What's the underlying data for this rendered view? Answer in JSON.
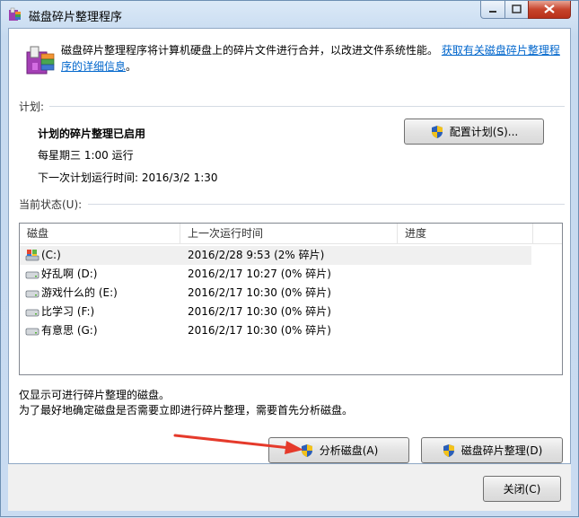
{
  "window": {
    "title": "磁盘碎片整理程序"
  },
  "header": {
    "description": "磁盘碎片整理程序将计算机硬盘上的碎片文件进行合并，以改进文件系统性能。",
    "link": "获取有关磁盘碎片整理程序的详细信息",
    "link_end": "。"
  },
  "schedule": {
    "section_label": "计划:",
    "status": "计划的碎片整理已启用",
    "frequency": "每星期三  1:00 运行",
    "next_run": "下一次计划运行时间: 2016/3/2 1:30",
    "configure_button": "配置计划(S)..."
  },
  "current_status": {
    "section_label": "当前状态(U):",
    "columns": [
      "磁盘",
      "上一次运行时间",
      "进度"
    ],
    "rows": [
      {
        "disk": "(C:)",
        "last_run": "2016/2/28 9:53 (2% 碎片)",
        "progress": "",
        "icon": "system-drive-icon"
      },
      {
        "disk": "好乱啊 (D:)",
        "last_run": "2016/2/17 10:27 (0% 碎片)",
        "progress": "",
        "icon": "drive-icon"
      },
      {
        "disk": "游戏什么的 (E:)",
        "last_run": "2016/2/17 10:30 (0% 碎片)",
        "progress": "",
        "icon": "drive-icon"
      },
      {
        "disk": "比学习 (F:)",
        "last_run": "2016/2/17 10:30 (0% 碎片)",
        "progress": "",
        "icon": "drive-icon"
      },
      {
        "disk": "有意思 (G:)",
        "last_run": "2016/2/17 10:30 (0% 碎片)",
        "progress": "",
        "icon": "drive-icon"
      }
    ]
  },
  "notes": {
    "line1": "仅显示可进行碎片整理的磁盘。",
    "line2": "为了最好地确定磁盘是否需要立即进行碎片整理，需要首先分析磁盘。"
  },
  "actions": {
    "analyze_button": "分析磁盘(A)",
    "defrag_button": "磁盘碎片整理(D)",
    "close_button": "关闭(C)"
  },
  "colors": {
    "link": "#0066cc",
    "annotation_arrow": "#e53a2b"
  }
}
